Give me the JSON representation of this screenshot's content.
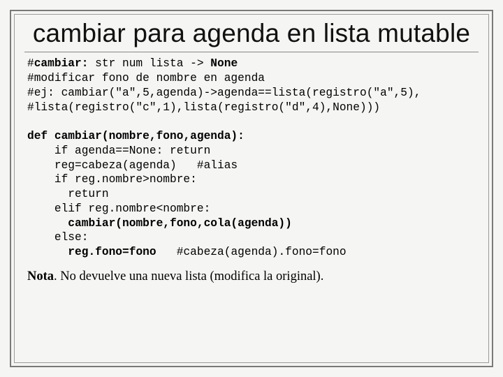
{
  "title": "cambiar para agenda en lista mutable",
  "comment_sig1": "#",
  "comment_sig2": "cambiar:",
  "comment_sig3": " str num lista -> ",
  "comment_sig4": "None",
  "comment_desc": "#modificar fono de nombre en agenda",
  "comment_ex1": "#ej: cambiar(\"a\",5,agenda)->agenda==lista(registro(\"a\",5),",
  "comment_ex2": "#lista(registro(\"c\",1),lista(registro(\"d\",4),None)))",
  "def_kw": "def",
  "def_sig": " cambiar(nombre,fono,agenda):",
  "line_if_none": "    if agenda==None: return",
  "line_reg": "    reg=cabeza(agenda)   #alias",
  "line_if_gt": "    if reg.nombre>nombre:",
  "line_return": "      return",
  "line_elif": "    elif reg.nombre<nombre:",
  "line_recurse": "      cambiar(nombre,fono,cola(agenda))",
  "line_else": "    else:",
  "line_assign1": "      ",
  "line_assign_bold": "reg.fono=fono",
  "line_assign_tail": "   #cabeza(agenda).fono=fono",
  "note_bold": "Nota",
  "note_rest": ". No devuelve una nueva lista (modifica la original)."
}
